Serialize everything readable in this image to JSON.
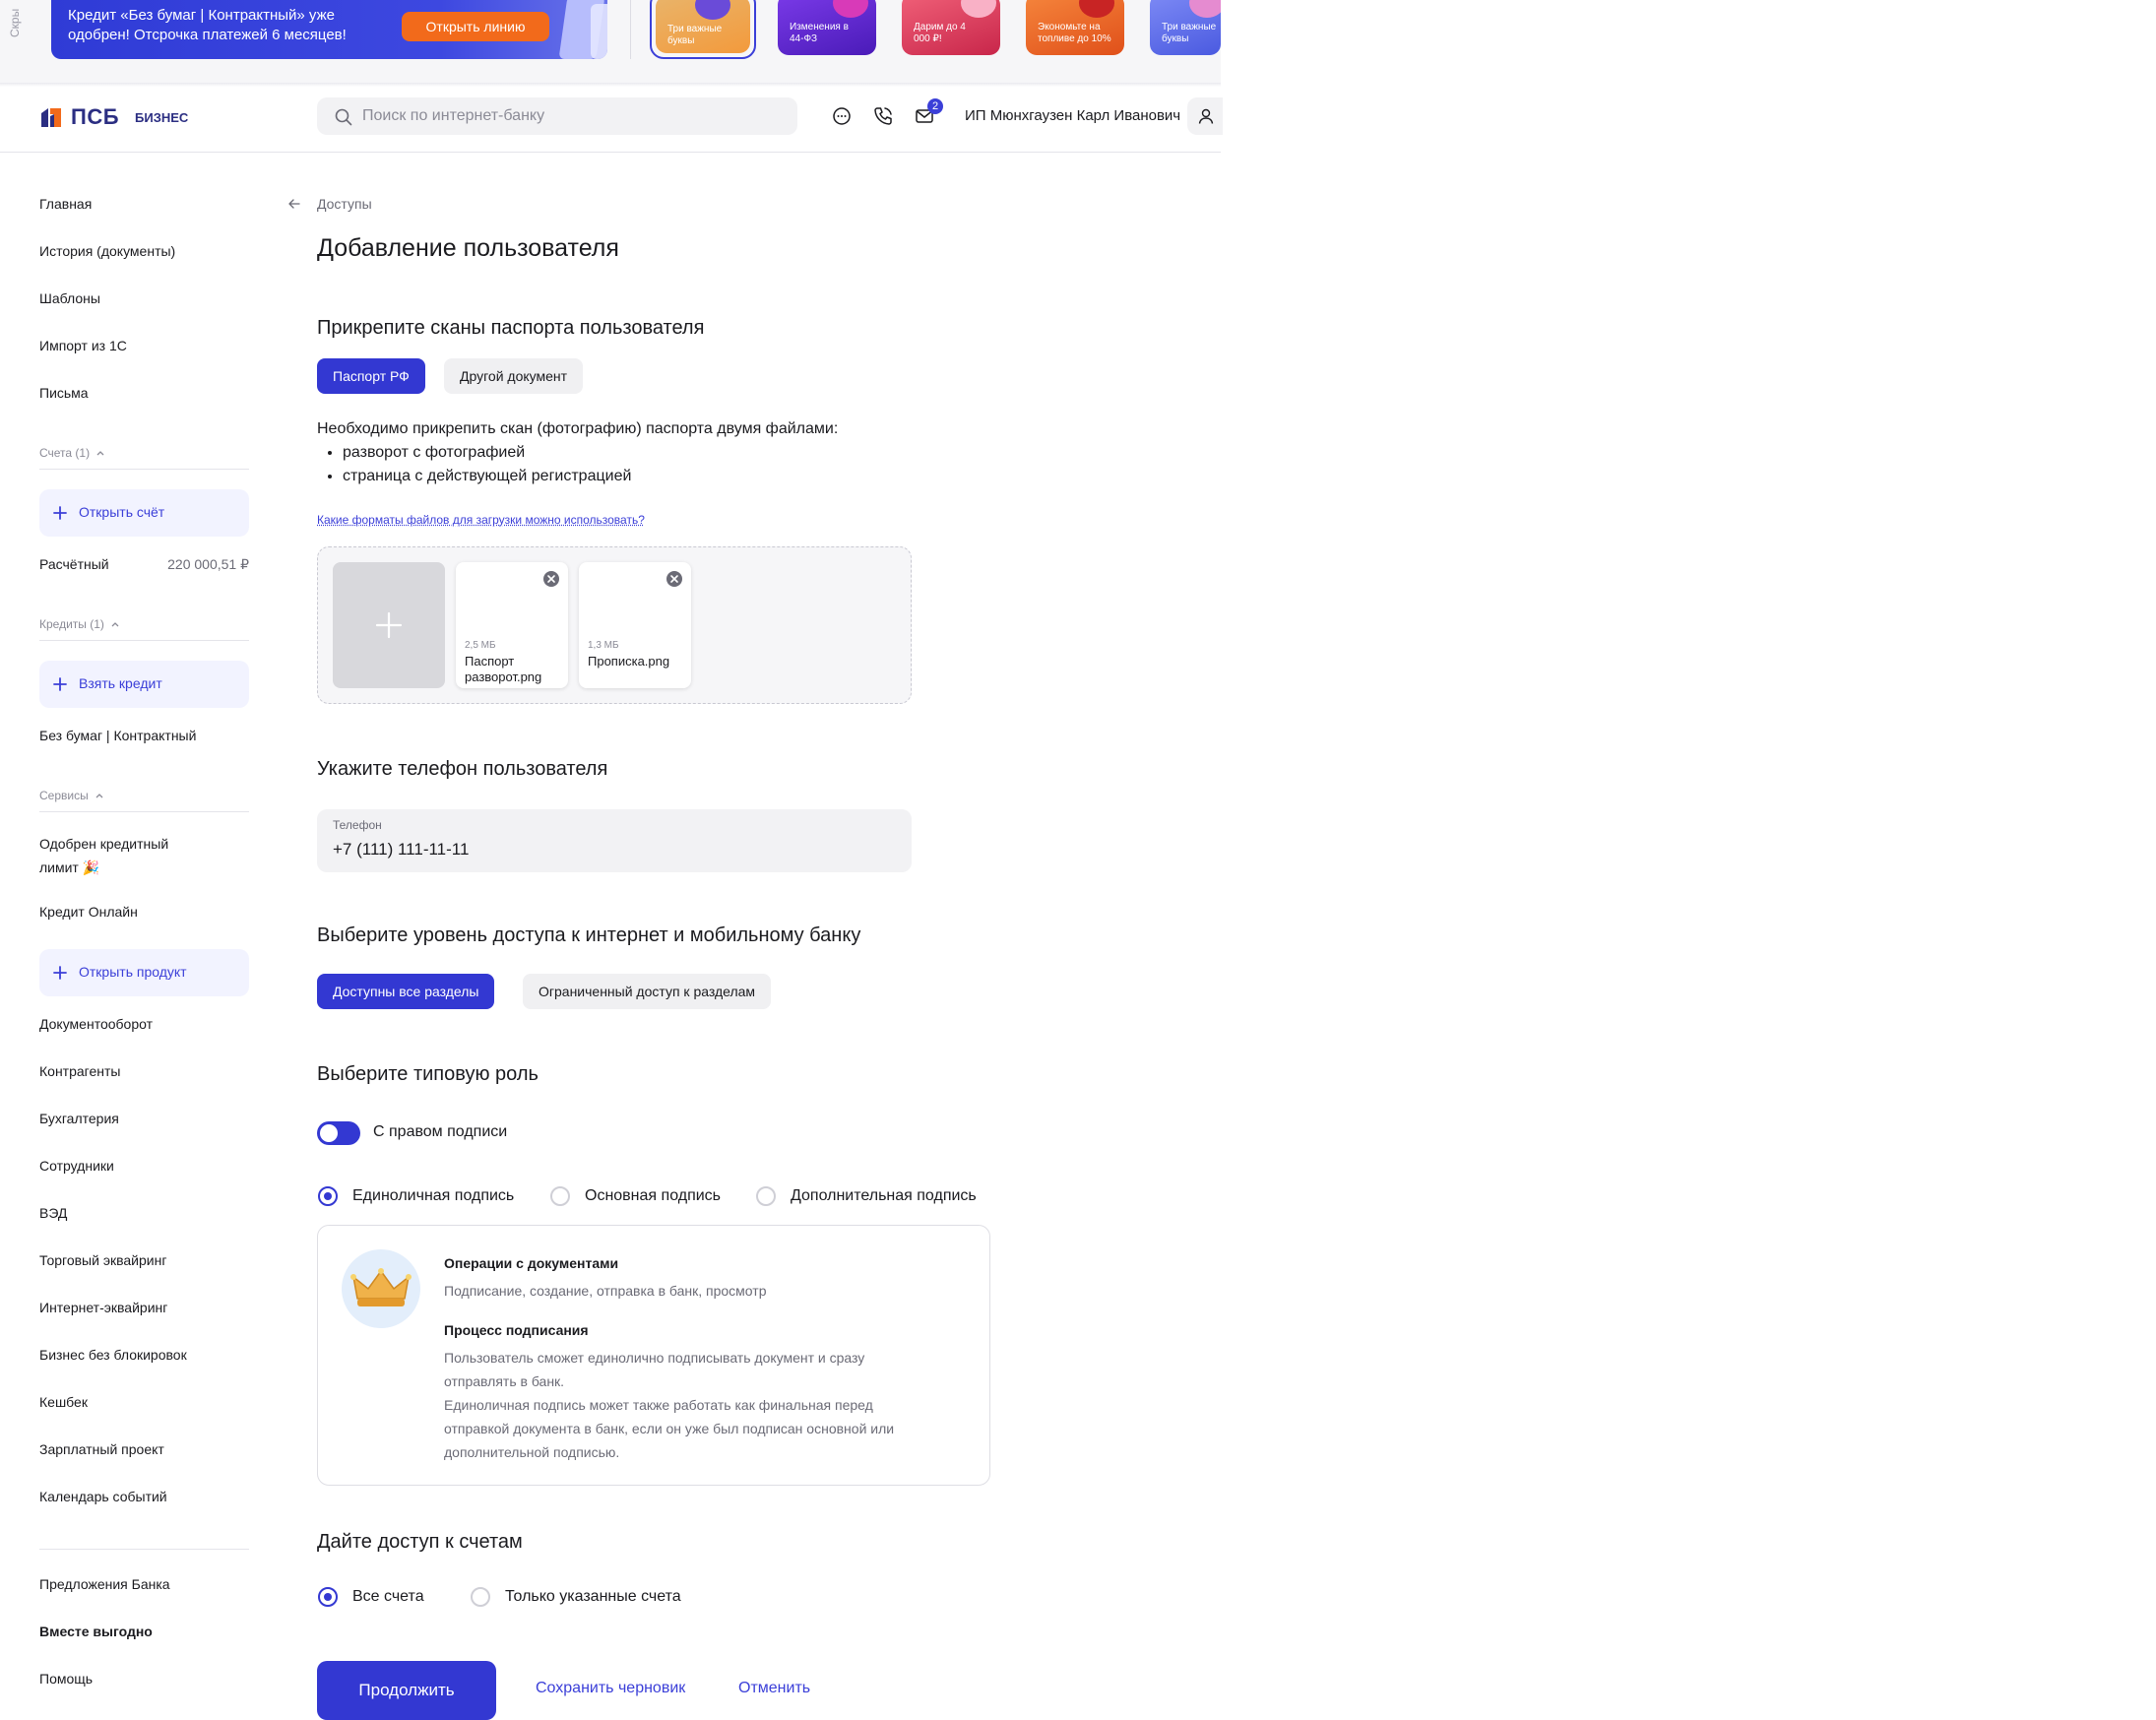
{
  "promo": {
    "side_text": "Скры",
    "banner_text": "Кредит «Без бумаг | Контрактный» уже одобрен! Отсрочка платежей 6 месяцев!",
    "banner_button": "Открыть линию",
    "stories": [
      {
        "title": "Три важные буквы",
        "color": "#f39a3c"
      },
      {
        "title": "Изменения в 44-ФЗ",
        "color": "#6b2bd8"
      },
      {
        "title": "Дарим до 4 000 ₽!",
        "color": "#e8415a"
      },
      {
        "title": "Экономьте на топливе до 10%",
        "color": "#f0641e"
      },
      {
        "title": "Три важные буквы",
        "color": "#5a6ef0"
      }
    ]
  },
  "header": {
    "logo_name": "ПСБ",
    "logo_suffix": "БИЗНЕС",
    "search_placeholder": "Поиск по интернет-банку",
    "notifications_count": "2",
    "user_name": "ИП Мюнхгаузен Карл Иванович"
  },
  "sidebar": {
    "top_items": [
      "Главная",
      "История (документы)",
      "Шаблоны",
      "Импорт из 1С",
      "Письма"
    ],
    "accounts_header": "Счета (1)",
    "open_account": "Открыть счёт",
    "account_name": "Расчётный",
    "account_balance": "220 000,51 ₽",
    "credits_header": "Кредиты (1)",
    "take_credit": "Взять кредит",
    "credit_name": "Без бумаг | Контрактный",
    "services_header": "Сервисы",
    "service_approved": "Одобрен кредитный лимит 🎉",
    "service_credit_online": "Кредит Онлайн",
    "open_product": "Открыть продукт",
    "services": [
      "Документооборот",
      "Контрагенты",
      "Бухгалтерия",
      "Сотрудники",
      "ВЭД",
      "Торговый эквайринг",
      "Интернет-эквайринг",
      "Бизнес без блокировок",
      "Кешбек",
      "Зарплатный проект",
      "Календарь событий"
    ],
    "bank_offers": "Предложения Банка",
    "together": "Вместе выгодно",
    "help": "Помощь"
  },
  "main": {
    "breadcrumb": "Доступы",
    "title": "Добавление пользователя",
    "passport_section": "Прикрепите сканы паспорта пользователя",
    "doc_tabs": [
      "Паспорт РФ",
      "Другой документ"
    ],
    "instructions": "Необходимо прикрепить скан (фотографию) паспорта двумя файлами:",
    "instructions_items": [
      "разворот с фотографией",
      "страница с действующей регистрацией"
    ],
    "formats_link": "Какие форматы файлов для загрузки можно использовать?",
    "files": [
      {
        "size": "2,5 МБ",
        "name": "Паспорт разворот.png"
      },
      {
        "size": "1,3 МБ",
        "name": "Прописка.png"
      }
    ],
    "phone_section": "Укажите телефон пользователя",
    "phone_label": "Телефон",
    "phone_value": "+7 (111) 111-11-11",
    "access_section": "Выберите уровень доступа к интернет и мобильному банку",
    "access_tabs": [
      "Доступны все разделы",
      "Ограниченный доступ к разделам"
    ],
    "role_section": "Выберите типовую роль",
    "sign_toggle_label": "С правом подписи",
    "sign_toggle_on": true,
    "sign_options": [
      "Единоличная подпись",
      "Основная подпись",
      "Дополнительная подпись"
    ],
    "sign_selected": "Единоличная подпись",
    "role_card": {
      "ops_title": "Операции с документами",
      "ops_text": "Подписание, создание, отправка в банк, просмотр",
      "process_title": "Процесс подписания",
      "process_text_1": "Пользователь сможет единолично подписывать документ и сразу отправлять в банк.",
      "process_text_2": "Единоличная подпись может также работать как финальная перед отправкой документа в банк, если он уже был подписан основной или дополнительной подписью."
    },
    "accounts_section": "Дайте доступ к счетам",
    "account_options": [
      "Все счета",
      "Только указанные счета"
    ],
    "account_selected": "Все счета",
    "continue_button": "Продолжить",
    "draft_button": "Сохранить черновик",
    "cancel_button": "Отменить"
  },
  "colors": {
    "accent": "#3338d2",
    "brand": "#2b2e82",
    "promo_orange": "#f26a1b"
  }
}
